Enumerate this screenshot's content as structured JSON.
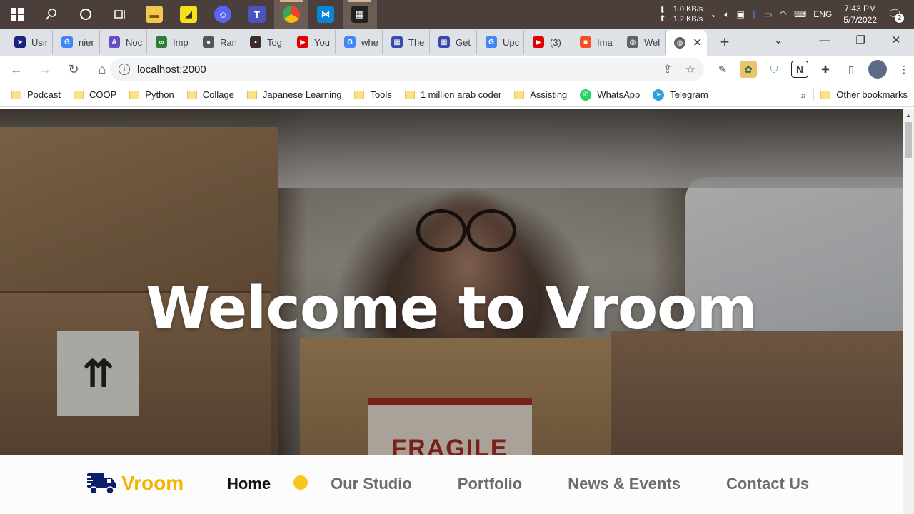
{
  "taskbar": {
    "apps": [
      {
        "icon": "file-explorer-icon",
        "color": "#f2c94c",
        "glyph": "▬"
      },
      {
        "icon": "sticky-notes-icon",
        "color": "#f7e11d",
        "glyph": "◢"
      },
      {
        "icon": "discord-icon",
        "color": "#5865f2",
        "glyph": "☺"
      },
      {
        "icon": "teams-icon",
        "color": "#4b53bc",
        "glyph": "T"
      },
      {
        "icon": "chrome-icon",
        "color": "#34a853",
        "glyph": "◉"
      },
      {
        "icon": "vscode-icon",
        "color": "#0a84d6",
        "glyph": "⋈"
      },
      {
        "icon": "video-editor-icon",
        "color": "#222222",
        "glyph": "▦"
      }
    ],
    "net_down": "1.0 KB/s",
    "net_up": "1.2 KB/s",
    "language": "ENG",
    "time": "7:43 PM",
    "date": "5/7/2022",
    "notifications": "2"
  },
  "tabs": [
    {
      "title": "Usir",
      "icon": "arrow-favicon-icon",
      "color": "#1a237e",
      "glyph": "➤"
    },
    {
      "title": "nier",
      "icon": "google-favicon-icon",
      "color": "#4285f4",
      "glyph": "G"
    },
    {
      "title": "Noc",
      "icon": "notion-like-favicon-icon",
      "color": "#6a4cc5",
      "glyph": "A"
    },
    {
      "title": "Imp",
      "icon": "infinity-favicon-icon",
      "color": "#2e7d32",
      "glyph": "∞"
    },
    {
      "title": "Ran",
      "icon": "github-favicon-icon",
      "color": "#555555",
      "glyph": "●"
    },
    {
      "title": "Tog",
      "icon": "avatar-favicon-icon",
      "color": "#3e2a2a",
      "glyph": "▪"
    },
    {
      "title": "You",
      "icon": "youtube-favicon-icon",
      "color": "#e00000",
      "glyph": "▶"
    },
    {
      "title": "whe",
      "icon": "google-favicon-icon",
      "color": "#4285f4",
      "glyph": "G"
    },
    {
      "title": "The",
      "icon": "grid-favicon-icon",
      "color": "#3949ab",
      "glyph": "▦"
    },
    {
      "title": "Get",
      "icon": "grid-favicon-icon",
      "color": "#3949ab",
      "glyph": "▦"
    },
    {
      "title": "Upc",
      "icon": "google-favicon-icon",
      "color": "#4285f4",
      "glyph": "G"
    },
    {
      "title": "(3)",
      "icon": "youtube-favicon-icon",
      "color": "#e00000",
      "glyph": "▶"
    },
    {
      "title": "Ima",
      "icon": "microsoft-favicon-icon",
      "color": "#f25022",
      "glyph": "■"
    },
    {
      "title": "Wel",
      "icon": "globe-favicon-icon",
      "color": "#5f6368",
      "glyph": "◍"
    }
  ],
  "active_tab": {
    "icon": "globe-favicon-icon",
    "glyph": "◍"
  },
  "address": "localhost:2000",
  "bookmarks": [
    {
      "label": "Podcast",
      "type": "folder"
    },
    {
      "label": "COOP",
      "type": "folder"
    },
    {
      "label": "Python",
      "type": "folder"
    },
    {
      "label": "Collage",
      "type": "folder"
    },
    {
      "label": "Japanese Learning",
      "type": "folder"
    },
    {
      "label": "Tools",
      "type": "folder"
    },
    {
      "label": "1 million arab coder",
      "type": "folder"
    },
    {
      "label": "Assisting",
      "type": "folder"
    },
    {
      "label": "WhatsApp",
      "type": "link",
      "icon": "whatsapp-icon",
      "color": "#25d366"
    },
    {
      "label": "Telegram",
      "type": "link",
      "icon": "telegram-icon",
      "color": "#2aa3df"
    }
  ],
  "bookmarks_more": "»",
  "other_bookmarks": "Other bookmarks",
  "hero": {
    "title": "Welcome to Vroom",
    "sign_text": "FRAGILE"
  },
  "site_nav": {
    "logo": "Vroom",
    "logo_color": "#f5b400",
    "links": [
      "Home",
      "Our Studio",
      "Portfolio",
      "News & Events",
      "Contact Us"
    ],
    "active_index": 0,
    "accent": "#f7c61f"
  }
}
